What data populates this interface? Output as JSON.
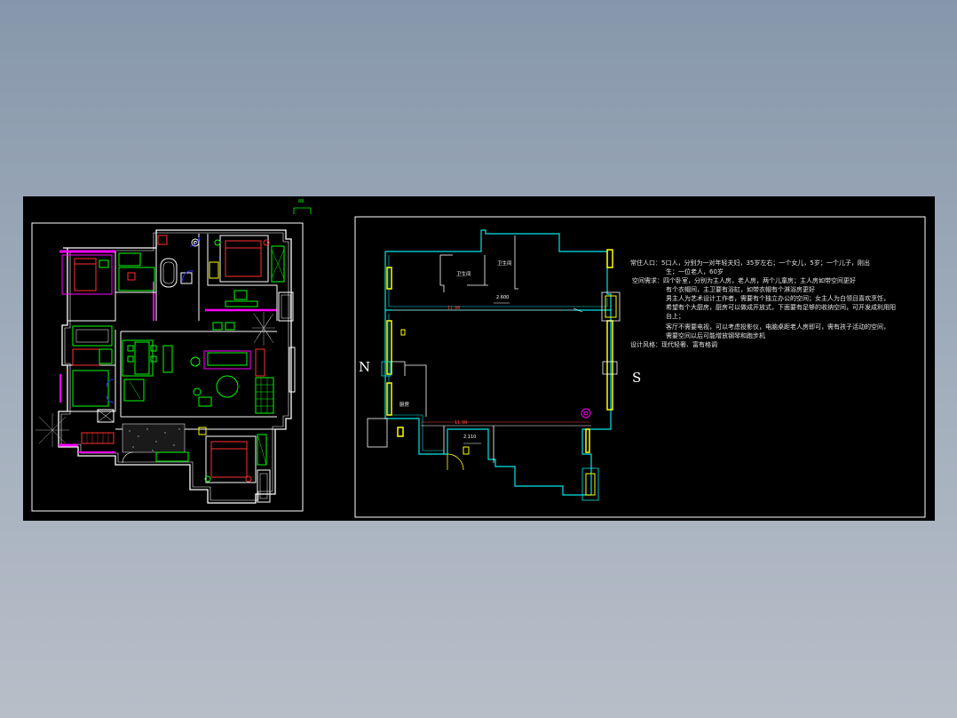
{
  "drawing": {
    "compass_north": "N",
    "compass_south": "S",
    "top_tag": "88",
    "room_labels": [
      "卫生间",
      "卫生间",
      "厨房"
    ],
    "dimensions": [
      "2.600",
      "11.98",
      "11.98",
      "2.110"
    ]
  },
  "notes": {
    "lines": [
      "常住人口：5口人，分别为一对年轻夫妇，35岁左右；一个女儿，5岁；一个儿子，刚出",
      "生；一位老人，60岁",
      "空间需求：四个卧室，分别为主人房，老人房，两个儿童房；主人房如带空间更好",
      "有个衣帽间，主卫要有浴缸，如带衣帽有个淋浴房更好",
      "男主人为艺术设计工作者，需要有个独立办公的空间；女主人为白领且喜欢烹饪，",
      "希望有个大厨房，厨房可以做成开放式，下面要有足够的收纳空间，可开发成利用阳",
      "台上；",
      "客厅不需要电视，可以考虑投影仪，电脑桌距老人房即可，需有孩子活动的空间，",
      "需要空间以后可能增放钢琴和跑步机",
      "设计风格：现代轻奢、富有格调"
    ]
  },
  "colors": {
    "background": "#000000",
    "wall_cyan": "#00e5e5",
    "window_yellow": "#ffff00",
    "door_yellow": "#ffff00",
    "wall_white": "#ffffff",
    "magenta": "#ff00ff",
    "furniture_green": "#00ff00",
    "bed_red": "#ff3030",
    "dim_red": "#ff4040",
    "hatch_grey": "#b0b0b0"
  }
}
